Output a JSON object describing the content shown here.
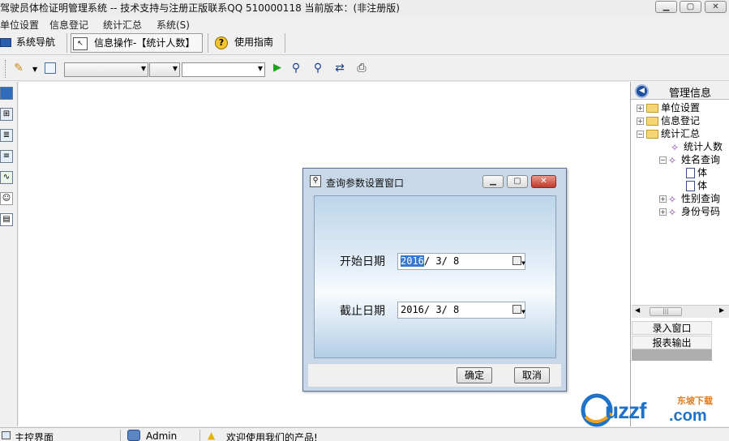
{
  "window": {
    "title": "驾驶员体检证明管理系统 -- 技术支持与注册正版联系QQ 510000118   当前版本：(非注册版)"
  },
  "menu": [
    "单位设置",
    "信息登记",
    "统计汇总",
    "系统(S)"
  ],
  "tabs": {
    "nav": "系统导航",
    "active": "信息操作-【统计人数】",
    "help": "使用指南"
  },
  "tree": {
    "header": "管理信息",
    "items": [
      {
        "label": "单位设置",
        "icon": "folder-icon",
        "expander": "+"
      },
      {
        "label": "信息登记",
        "icon": "folder-icon",
        "expander": "+"
      },
      {
        "label": "统计汇总",
        "icon": "folder-icon",
        "expander": "−"
      },
      {
        "label": "统计人数",
        "icon": "magic-wand-icon",
        "expander": ""
      },
      {
        "label": "姓名查询",
        "icon": "magic-wand-icon",
        "expander": "−"
      },
      {
        "label": "体",
        "icon": "document-icon",
        "expander": ""
      },
      {
        "label": "体",
        "icon": "document-icon",
        "expander": ""
      },
      {
        "label": "性别查询",
        "icon": "magic-wand-icon",
        "expander": "+"
      },
      {
        "label": "身份号码",
        "icon": "magic-wand-icon",
        "expander": "+"
      }
    ],
    "buttons": [
      "录入窗口",
      "报表输出"
    ]
  },
  "dialog": {
    "title": "查询参数设置窗口",
    "start_label": "开始日期",
    "start_sel": "2016",
    "start_rest": "/ 3/ 8",
    "end_label": "截止日期",
    "end_value": "2016/ 3/ 8",
    "ok": "确定",
    "cancel": "取消"
  },
  "status": {
    "left": "主控界面",
    "user": "Admin",
    "message": "欢迎使用我们的产品!"
  },
  "watermark": {
    "brand": "uzzf",
    "dot": ".com",
    "tag": "东坡下载"
  },
  "colors": {
    "accent": "#3478d3",
    "dialog_bg": "#c8d8e8"
  }
}
